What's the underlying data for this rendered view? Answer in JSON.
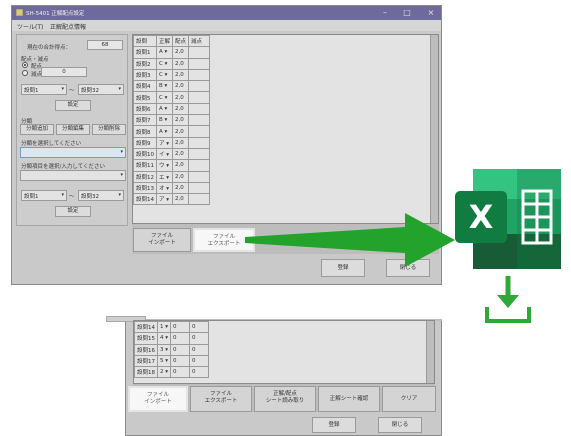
{
  "window": {
    "title": "SH-5401 正解配点設定",
    "menu": [
      "ツール(T)",
      "正解配点情報"
    ]
  },
  "left_panel": {
    "total_label": "現在の合計得点：",
    "total_value": "68",
    "score_mode_label": "配点・減点",
    "radio_add": "配点",
    "radio_sub": "減点",
    "points_value": "0",
    "range_from": "設問1",
    "range_tilde": "～",
    "range_to": "設問32",
    "set_button": "設定",
    "category_label": "分類",
    "cat_add": "分類追加",
    "cat_edit": "分類編集",
    "cat_delete": "分類削除",
    "cat_select_label": "分類を選択してください",
    "cat_item_label": "分類項目を選択/入力してください",
    "range2_from": "設問1",
    "range2_to": "設問32",
    "set_button2": "設定"
  },
  "grid": {
    "headers": [
      "設問",
      "正解",
      "配点",
      "減点"
    ],
    "rows": [
      {
        "q": "設問1",
        "ans": "A",
        "pts": "2,0"
      },
      {
        "q": "設問2",
        "ans": "C",
        "pts": "2,0"
      },
      {
        "q": "設問3",
        "ans": "C",
        "pts": "2,0"
      },
      {
        "q": "設問4",
        "ans": "B",
        "pts": "2,0"
      },
      {
        "q": "設問5",
        "ans": "C",
        "pts": "2,0"
      },
      {
        "q": "設問6",
        "ans": "A",
        "pts": "2,0"
      },
      {
        "q": "設問7",
        "ans": "B",
        "pts": "2,0"
      },
      {
        "q": "設問8",
        "ans": "A",
        "pts": "2,0"
      },
      {
        "q": "設問9",
        "ans": "ア",
        "pts": "2,0"
      },
      {
        "q": "設問10",
        "ans": "イ",
        "pts": "2,0"
      },
      {
        "q": "設問11",
        "ans": "ウ",
        "pts": "2,0"
      },
      {
        "q": "設問12",
        "ans": "エ",
        "pts": "2,0"
      },
      {
        "q": "設問13",
        "ans": "オ",
        "pts": "2,0"
      },
      {
        "q": "設問14",
        "ans": "ア",
        "pts": "2,0"
      }
    ]
  },
  "bottom_buttons": {
    "import": "ファイル\nインポート",
    "export": "ファイル\nエクスポート",
    "register": "登録",
    "close": "閉じる"
  },
  "lower": {
    "rows": [
      {
        "q": "設問14",
        "ans": "1",
        "pts": "0",
        "ded": "0"
      },
      {
        "q": "設問15",
        "ans": "4",
        "pts": "0",
        "ded": "0"
      },
      {
        "q": "設問16",
        "ans": "3",
        "pts": "0",
        "ded": "0"
      },
      {
        "q": "設問17",
        "ans": "5",
        "pts": "0",
        "ded": "0"
      },
      {
        "q": "設問18",
        "ans": "2",
        "pts": "0",
        "ded": "0"
      }
    ],
    "import": "ファイル\nインポート",
    "export": "ファイル\nエクスポート",
    "read_sheet": "正解/配点\nシート読み取り",
    "confirm_sheet": "正解シート確認",
    "clear": "クリア",
    "register": "登録",
    "close": "閉じる"
  },
  "excel_icon": {
    "letter": "X",
    "brand_color": "#21a366"
  },
  "arrow_color": "#23a22c"
}
